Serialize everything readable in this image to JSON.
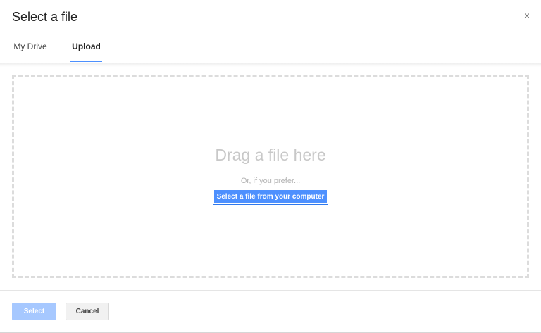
{
  "dialog": {
    "title": "Select a file",
    "close_glyph": "×"
  },
  "tabs": [
    {
      "label": "My Drive",
      "active": false
    },
    {
      "label": "Upload",
      "active": true
    }
  ],
  "upload": {
    "drag_text": "Drag a file here",
    "or_text": "Or, if you prefer...",
    "select_button": "Select a file from your computer"
  },
  "footer": {
    "select_label": "Select",
    "cancel_label": "Cancel"
  },
  "colors": {
    "accent": "#4d90fe",
    "disabled_primary": "#a6c8ff"
  }
}
